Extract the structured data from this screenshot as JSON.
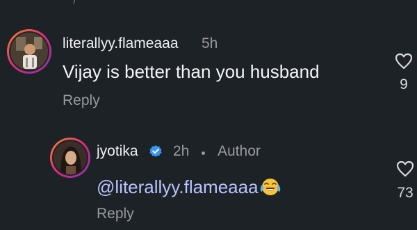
{
  "top_fragment": "' )",
  "comments": [
    {
      "username": "literallyy.flameaaa",
      "time": "5h",
      "text": "Vijay is better than you husband",
      "reply_label": "Reply",
      "likes": "9",
      "like_icon": "heart-outline-icon",
      "avatar_icon": "profile-photo-icon"
    },
    {
      "username": "jyotika",
      "time": "2h",
      "author_label": "Author",
      "mention": "@literallyy.flameaaa",
      "emoji": "tears-of-joy-emoji",
      "reply_label": "Reply",
      "likes": "73",
      "like_icon": "heart-outline-icon",
      "verified_icon": "verified-badge-icon",
      "verified_color": "#3897f0",
      "avatar_icon": "profile-photo-icon"
    }
  ]
}
